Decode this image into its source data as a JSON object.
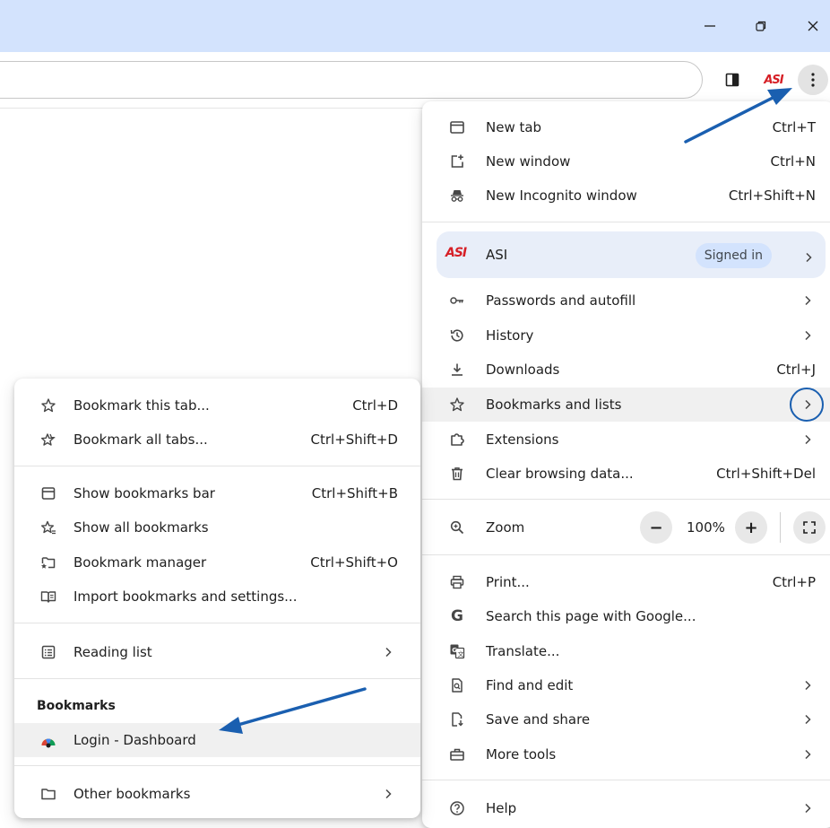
{
  "window": {
    "minimize_icon": "minimize-icon",
    "restore_icon": "restore-icon",
    "close_icon": "close-icon"
  },
  "toolbar": {
    "asi_logo": "ASI"
  },
  "main_menu": {
    "new_tab": {
      "label": "New tab",
      "shortcut": "Ctrl+T"
    },
    "new_window": {
      "label": "New window",
      "shortcut": "Ctrl+N"
    },
    "new_incognito": {
      "label": "New Incognito window",
      "shortcut": "Ctrl+Shift+N"
    },
    "profile": {
      "logo": "ASI",
      "name": "ASI",
      "badge": "Signed in"
    },
    "passwords": {
      "label": "Passwords and autofill"
    },
    "history": {
      "label": "History"
    },
    "downloads": {
      "label": "Downloads",
      "shortcut": "Ctrl+J"
    },
    "bookmarks": {
      "label": "Bookmarks and lists"
    },
    "extensions": {
      "label": "Extensions"
    },
    "clear_data": {
      "label": "Clear browsing data...",
      "shortcut": "Ctrl+Shift+Del"
    },
    "zoom": {
      "label": "Zoom",
      "minus": "−",
      "value": "100%",
      "plus": "+"
    },
    "print": {
      "label": "Print...",
      "shortcut": "Ctrl+P"
    },
    "search_google": {
      "label": "Search this page with Google..."
    },
    "translate": {
      "label": "Translate..."
    },
    "find_edit": {
      "label": "Find and edit"
    },
    "save_share": {
      "label": "Save and share"
    },
    "more_tools": {
      "label": "More tools"
    },
    "help": {
      "label": "Help"
    }
  },
  "bookmarks_menu": {
    "bookmark_tab": {
      "label": "Bookmark this tab...",
      "shortcut": "Ctrl+D"
    },
    "bookmark_all": {
      "label": "Bookmark all tabs...",
      "shortcut": "Ctrl+Shift+D"
    },
    "show_bar": {
      "label": "Show bookmarks bar",
      "shortcut": "Ctrl+Shift+B"
    },
    "show_all": {
      "label": "Show all bookmarks"
    },
    "manager": {
      "label": "Bookmark manager",
      "shortcut": "Ctrl+Shift+O"
    },
    "import": {
      "label": "Import bookmarks and settings..."
    },
    "reading_list": {
      "label": "Reading list"
    },
    "section_title": "Bookmarks",
    "login_dashboard": {
      "label": "Login - Dashboard"
    },
    "other_bookmarks": {
      "label": "Other bookmarks"
    }
  },
  "colors": {
    "titlebar": "#d3e3fd",
    "accent_blue": "#1a5fb0",
    "asi_red": "#d61f26",
    "highlight": "#f0f0f0"
  }
}
